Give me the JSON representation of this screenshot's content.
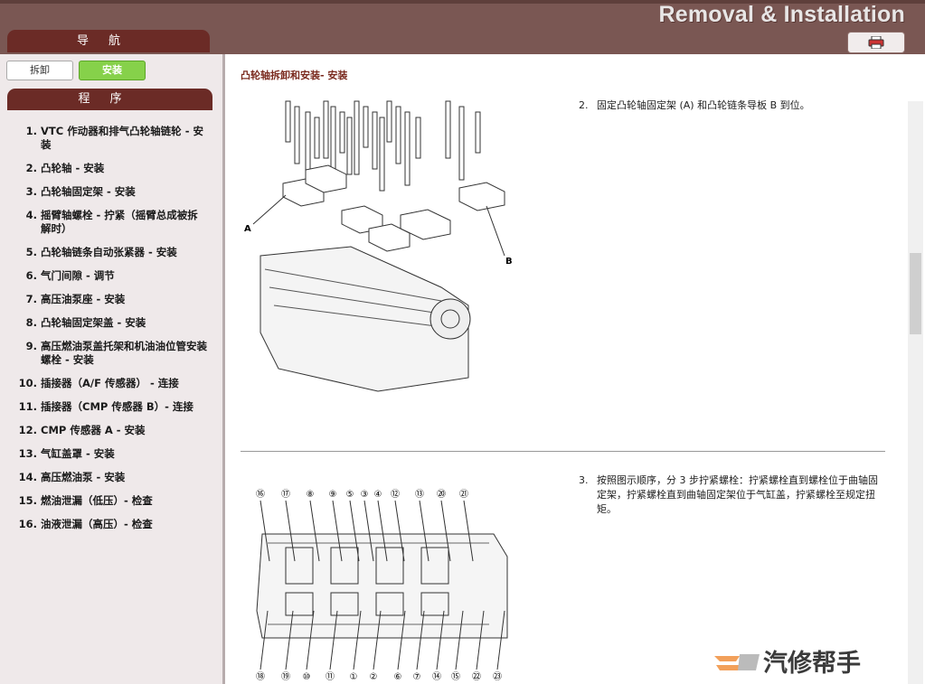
{
  "header": {
    "brand": "Removal & Installation",
    "nav_tab": "导航",
    "print_icon": "printer-icon"
  },
  "sidebar": {
    "remove_button": "拆卸",
    "install_button": "安装",
    "procedure_tab": "程序",
    "items": [
      {
        "num": "1.",
        "label": "VTC 作动器和排气凸轮轴链轮 - 安装"
      },
      {
        "num": "2.",
        "label": "凸轮轴 - 安装"
      },
      {
        "num": "3.",
        "label": "凸轮轴固定架 - 安装"
      },
      {
        "num": "4.",
        "label": "摇臂轴螺栓 - 拧紧（摇臂总成被拆解时）"
      },
      {
        "num": "5.",
        "label": "凸轮轴链条自动张紧器 - 安装"
      },
      {
        "num": "6.",
        "label": "气门间隙 - 调节"
      },
      {
        "num": "7.",
        "label": "高压油泵座 - 安装"
      },
      {
        "num": "8.",
        "label": "凸轮轴固定架盖 - 安装"
      },
      {
        "num": "9.",
        "label": "高压燃油泵盖托架和机油油位管安装螺栓 - 安装"
      },
      {
        "num": "10.",
        "label": "插接器（A/F 传感器） - 连接"
      },
      {
        "num": "11.",
        "label": "插接器（CMP 传感器 B）- 连接"
      },
      {
        "num": "12.",
        "label": "CMP 传感器 A - 安装"
      },
      {
        "num": "13.",
        "label": "气缸盖罩 - 安装"
      },
      {
        "num": "14.",
        "label": "高压燃油泵 - 安装"
      },
      {
        "num": "15.",
        "label": "燃油泄漏（低压）- 检查"
      },
      {
        "num": "16.",
        "label": "油液泄漏（高压）- 检查"
      }
    ]
  },
  "main": {
    "title": "凸轮轴拆卸和安装- 安装",
    "step2": {
      "num": "2.",
      "text": "固定凸轮轴固定架 (A) 和凸轮链条导板 B 到位。"
    },
    "step3": {
      "num": "3.",
      "text": "按照图示顺序，分 3 步拧紧螺栓：拧紧螺栓直到螺栓位于曲轴固定架，拧紧螺栓直到曲轴固定架位于气缸盖，拧紧螺栓至规定扭矩。"
    },
    "fig1_labels": {
      "a": "A",
      "b": "B"
    },
    "fig2_top": [
      "⑯",
      "⑰",
      "⑧",
      "⑨",
      "⑤",
      "③",
      "④",
      "⑫",
      "⑬",
      "⑳",
      "㉑"
    ],
    "fig2_bottom": [
      "⑱",
      "⑲",
      "⑩",
      "⑪",
      "①",
      "②",
      "⑥",
      "⑦",
      "⑭",
      "⑮",
      "㉒",
      "㉓"
    ]
  },
  "watermark": "汽修帮手"
}
